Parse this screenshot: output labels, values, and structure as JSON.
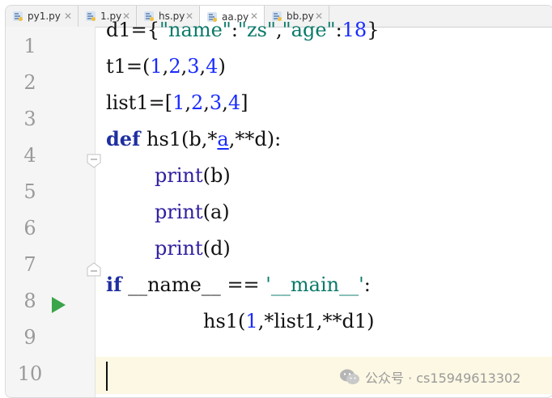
{
  "tabs": [
    {
      "label": "py1.py",
      "active": false
    },
    {
      "label": "1.py",
      "active": false
    },
    {
      "label": "hs.py",
      "active": false
    },
    {
      "label": "aa.py",
      "active": true
    },
    {
      "label": "bb.py",
      "active": false
    }
  ],
  "line_numbers": [
    "1",
    "2",
    "3",
    "4",
    "5",
    "6",
    "7",
    "8",
    "9",
    "10"
  ],
  "code": {
    "l1": {
      "a": "d1={",
      "b": "\"name\"",
      "c": ":",
      "d": "\"zs\"",
      "e": ",",
      "f": "\"age\"",
      "g": ":",
      "h": "18",
      "i": "}"
    },
    "l2": {
      "a": "t1=(",
      "b": "1",
      "c": ",",
      "d": "2",
      "e": ",",
      "f": "3",
      "g": ",",
      "h": "4",
      "i": ")"
    },
    "l3": {
      "a": "list1=[",
      "b": "1",
      "c": ",",
      "d": "2",
      "e": ",",
      "f": "3",
      "g": ",",
      "h": "4",
      "i": "]"
    },
    "l4": {
      "a": "def",
      "b": " hs1(b,*",
      "c": "a",
      "d": ",**d):"
    },
    "l5": {
      "a": "print",
      "b": "(b)"
    },
    "l6": {
      "a": "print",
      "b": "(a)"
    },
    "l7": {
      "a": "print",
      "b": "(d)"
    },
    "l8": {
      "a": "if",
      "b": " __name__ == ",
      "c": "'__main__'",
      "d": ":"
    },
    "l9": {
      "a": "hs1(",
      "b": "1",
      "c": ",*list1,**d1)"
    }
  },
  "watermark": "公众号 · cs15949613302",
  "icons": {
    "tab": "python-file-icon",
    "run": "run-arrow-icon",
    "fold": "fold-marker-icon",
    "watermark": "wechat-icon"
  },
  "colors": {
    "keyword": "#1f2fa0",
    "string": "#0a7a6a",
    "number": "#1a2cff",
    "run_arrow": "#3aa54a",
    "current_line": "#fcf8e3"
  }
}
